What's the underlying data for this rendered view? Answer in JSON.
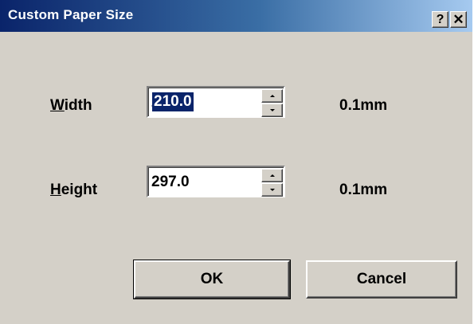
{
  "window": {
    "title": "Custom Paper Size",
    "help_label": "?",
    "close_label": "✕"
  },
  "fields": {
    "width": {
      "label_accel": "W",
      "label_rest": "idth",
      "value": "210.0",
      "unit": "0.1mm"
    },
    "height": {
      "label_accel": "H",
      "label_rest": "eight",
      "value": "297.0",
      "unit": "0.1mm"
    }
  },
  "buttons": {
    "ok_label": "OK",
    "cancel_label": "Cancel"
  },
  "colors": {
    "dialog_face": "#d4d0c8",
    "title_start": "#0a246a",
    "title_end": "#a6caf0",
    "selection": "#0a246a"
  },
  "icons": {
    "help": "help-icon",
    "close": "close-icon",
    "spin_up": "spin-up-arrow-icon",
    "spin_down": "spin-down-arrow-icon"
  }
}
